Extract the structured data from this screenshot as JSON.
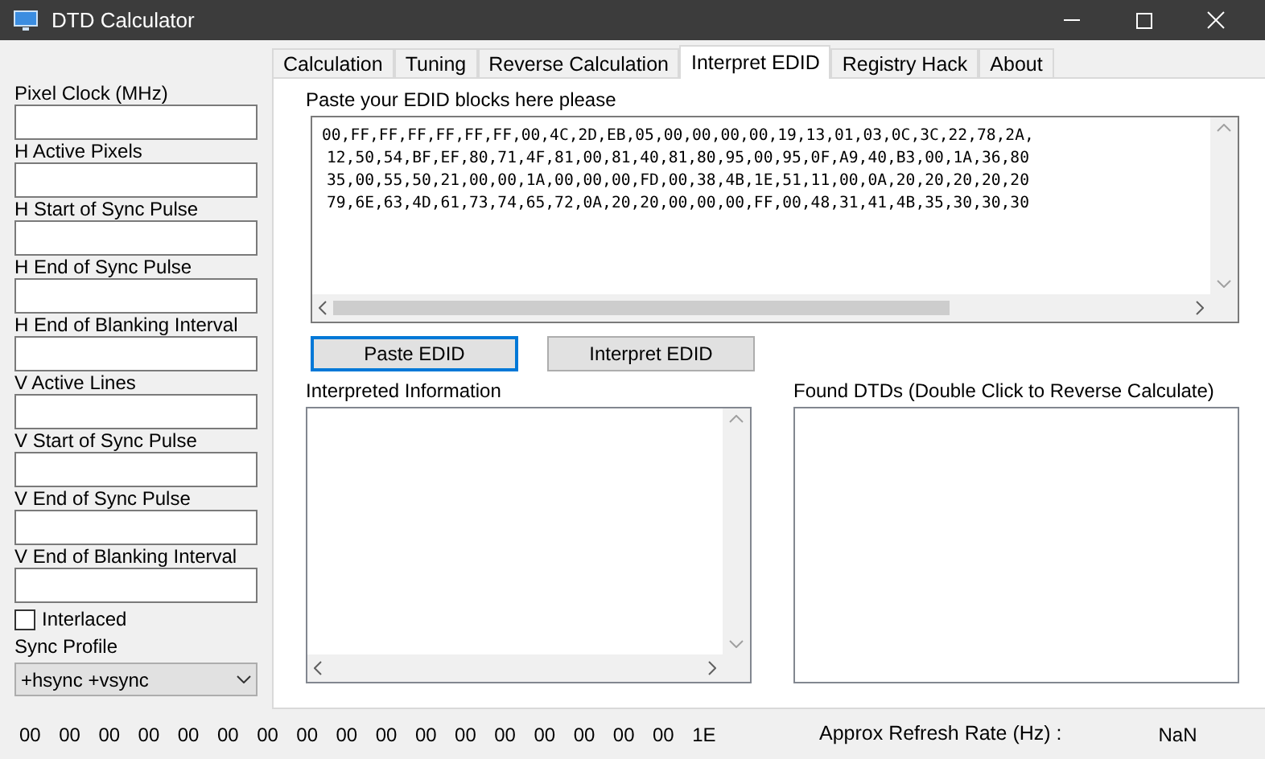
{
  "window": {
    "title": "DTD Calculator"
  },
  "fields": [
    {
      "label": "Pixel Clock (MHz)"
    },
    {
      "label": "H Active Pixels"
    },
    {
      "label": "H Start of Sync Pulse"
    },
    {
      "label": "H End of Sync Pulse"
    },
    {
      "label": "H End of Blanking Interval"
    },
    {
      "label": "V Active Lines"
    },
    {
      "label": "V Start of Sync Pulse"
    },
    {
      "label": "V End of Sync Pulse"
    },
    {
      "label": "V End of Blanking Interval"
    }
  ],
  "interlaced": {
    "label": "Interlaced",
    "checked": false
  },
  "sync_profile": {
    "label": "Sync Profile",
    "value": "+hsync +vsync"
  },
  "tabs": [
    {
      "label": "Calculation",
      "selected": false
    },
    {
      "label": "Tuning",
      "selected": false
    },
    {
      "label": "Reverse Calculation",
      "selected": false
    },
    {
      "label": "Interpret EDID",
      "selected": true
    },
    {
      "label": "Registry Hack",
      "selected": false
    },
    {
      "label": "About",
      "selected": false
    }
  ],
  "edid": {
    "label": "Paste your EDID blocks here please",
    "lines": [
      "00,FF,FF,FF,FF,FF,FF,00,4C,2D,EB,05,00,00,00,00,19,13,01,03,0C,3C,22,78,2A,",
      "12,50,54,BF,EF,80,71,4F,81,00,81,40,81,80,95,00,95,0F,A9,40,B3,00,1A,36,80",
      "35,00,55,50,21,00,00,1A,00,00,00,FD,00,38,4B,1E,51,11,00,0A,20,20,20,20,20",
      "79,6E,63,4D,61,73,74,65,72,0A,20,20,00,00,00,FF,00,48,31,41,4B,35,30,30,30"
    ]
  },
  "buttons": [
    {
      "label": "Paste EDID",
      "focused": true
    },
    {
      "label": "Interpret EDID",
      "focused": false
    }
  ],
  "interpreted": {
    "label": "Interpreted Information"
  },
  "found_dtds": {
    "label": "Found DTDs (Double Click to Reverse Calculate)"
  },
  "status_bar": {
    "bytes": [
      "00",
      "00",
      "00",
      "00",
      "00",
      "00",
      "00",
      "00",
      "00",
      "00",
      "00",
      "00",
      "00",
      "00",
      "00",
      "00",
      "00",
      "1E"
    ],
    "refresh_label": "Approx Refresh Rate (Hz) :",
    "refresh_value": "NaN"
  }
}
